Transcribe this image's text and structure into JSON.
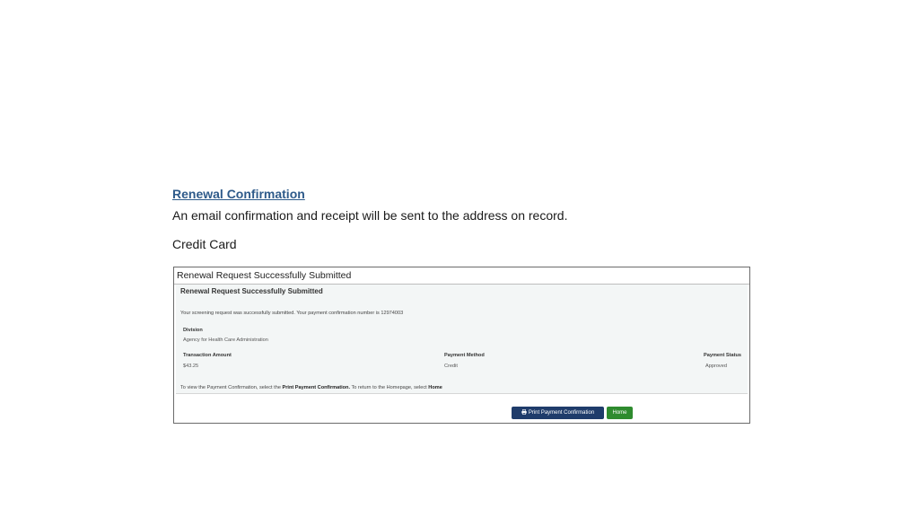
{
  "page": {
    "heading": "Renewal Confirmation",
    "intro": "An email confirmation and receipt will be sent to the address on record.",
    "method_label": "Credit Card"
  },
  "panel": {
    "title": "Renewal Request Successfully Submitted",
    "subtitle": "Renewal Request Successfully Submitted",
    "message": "Your screening request was successfully submitted. Your payment confirmation number is 12974003",
    "division_label": "Division",
    "division_value": "Agency for Health Care Administration",
    "amount_label": "Transaction Amount",
    "amount_value": "$43.25",
    "payment_method_label": "Payment Method",
    "payment_method_value": "Credit",
    "payment_status_label": "Payment Status",
    "payment_status_value": "Approved",
    "instruction_pre": "To view the Payment Confirmation, select the ",
    "instruction_bold1": "Print Payment Confirmation.",
    "instruction_mid": " To return to the Homepage, select ",
    "instruction_bold2": "Home"
  },
  "buttons": {
    "print_label": "Print Payment Confirmation",
    "print_icon": "printer-icon",
    "home_label": "Home"
  },
  "colors": {
    "heading": "#2e5a8a",
    "print_button": "#1f3c6b",
    "home_button": "#2e8b2e",
    "panel_body": "#f3f6f6"
  }
}
